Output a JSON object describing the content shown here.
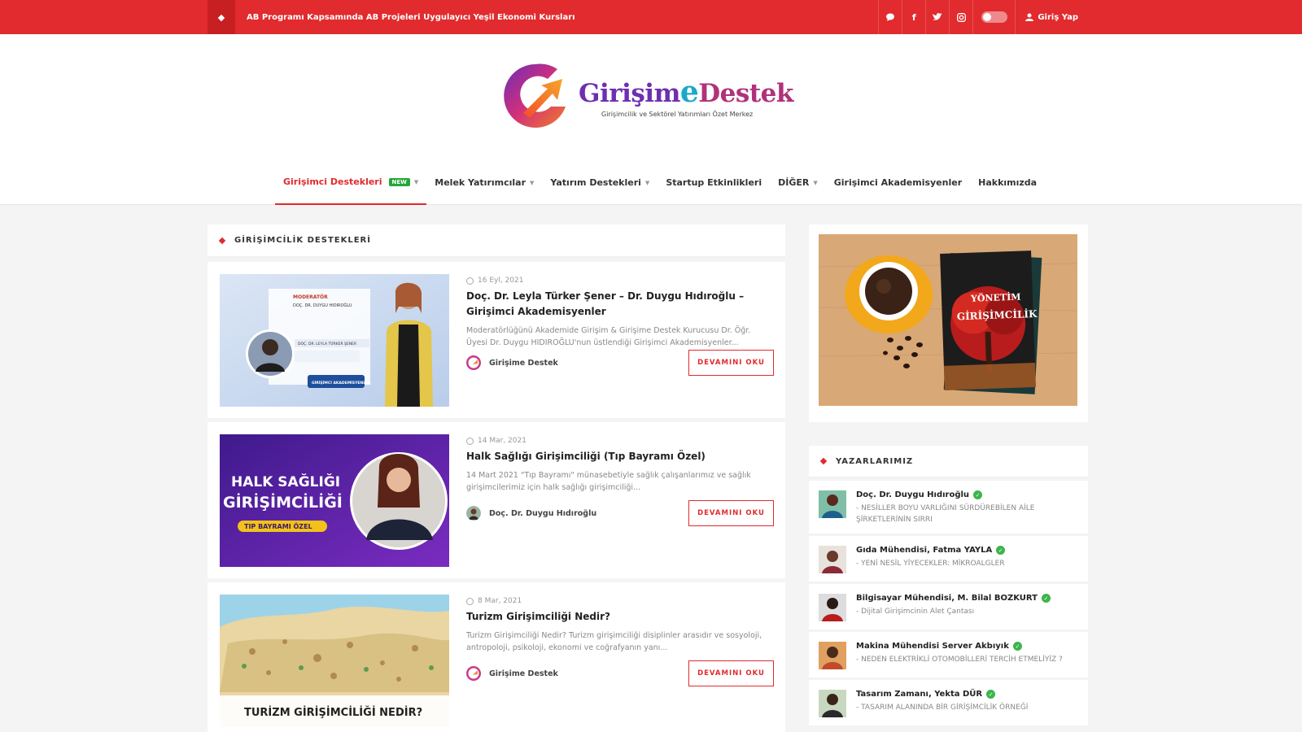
{
  "topbar": {
    "ticker": "AB Programı Kapsamında AB Projeleri Uygulayıcı Yeşil Ekonomi Kursları",
    "login_label": "Giriş Yap",
    "icons": [
      "chat-icon",
      "facebook-icon",
      "twitter-icon",
      "instagram-icon"
    ]
  },
  "header": {
    "logo_part1": "Girişim",
    "logo_e": "e",
    "logo_part2": "Destek",
    "tagline": "Girişimcilik ve Sektörel Yatırımları Özet Merkez"
  },
  "nav": {
    "items": [
      {
        "label": "Girişimci Destekleri",
        "badge": "NEW",
        "dropdown": true
      },
      {
        "label": "Melek Yatırımcılar",
        "dropdown": true
      },
      {
        "label": "Yatırım Destekleri",
        "dropdown": true
      },
      {
        "label": "Startup Etkinlikleri",
        "dropdown": false
      },
      {
        "label": "DİĞER",
        "dropdown": true
      },
      {
        "label": "Girişimci Akademisyenler",
        "dropdown": false
      },
      {
        "label": "Hakkımızda",
        "dropdown": false
      }
    ]
  },
  "main": {
    "section_title": "GİRİŞİMCİLİK DESTEKLERİ",
    "read_more": "DEVAMINI OKU",
    "posts": [
      {
        "date": "16 Eyl, 2021",
        "title": "Doç. Dr. Leyla Türker Şener – Dr. Duygu Hıdıroğlu – Girişimci Akademisyenler",
        "excerpt": "Moderatörlüğünü Akademide Girişim & Girişime Destek Kurucusu Dr. Öğr. Üyesi Dr. Duygu HIDIROĞLU'nun üstlendiği Girişimci Akademisyenler...",
        "author": "Girişime Destek"
      },
      {
        "date": "14 Mar, 2021",
        "title": "Halk Sağlığı Girişimciliği (Tıp Bayramı Özel)",
        "excerpt": "14 Mart 2021 \"Tıp Bayramı\" münasebetiyle sağlık çalışanlarımız ve sağlık girişimcilerimiz için halk sağlığı girişimciliği...",
        "author": "Doç. Dr. Duygu Hıdıroğlu"
      },
      {
        "date": "8 Mar, 2021",
        "title": "Turizm Girişimciliği Nedir?",
        "excerpt": "Turizm Girişimciliği Nedir? Turizm girişimciliği disiplinler arasıdır ve sosyoloji, antropoloji, psikoloji, ekonomi ve coğrafyanın yanı...",
        "author": "Girişime Destek"
      }
    ],
    "thumb1": {
      "tag": "MODERATÖR",
      "name": "DOÇ. DR. DUYGU HIDIROĞLU",
      "speaker": "DOÇ. DR. LEYLA TÜRKER ŞENER",
      "ribbon": "GİRİŞİMCİ AKADEMİSYENLER"
    },
    "thumb2": {
      "line1": "HALK SAĞLIĞI",
      "line2": "GİRİŞİMCİLİĞİ",
      "pill": "TIP BAYRAMI ÖZEL"
    },
    "thumb3": {
      "caption": "TURİZM GİRİŞİMCİLİĞİ NEDİR?"
    }
  },
  "sidebar": {
    "book_line1": "YÖNETİM",
    "book_line2": "GİRİŞİMCİLİK",
    "writers_title": "YAZARLARIMIZ",
    "writers": [
      {
        "name": "Doç. Dr. Duygu Hıdıroğlu",
        "post": "- NESİLLER BOYU VARLIĞINI SÜRDÜREBİLEN AİLE ŞİRKETLERİNİN SIRRI"
      },
      {
        "name": "Gıda Mühendisi, Fatma YAYLA",
        "post": "- YENİ NESİL YİYECEKLER: MİKROALGLER"
      },
      {
        "name": "Bilgisayar Mühendisi, M. Bilal BOZKURT",
        "post": "- Dijital Girişimcinin Alet Çantası"
      },
      {
        "name": "Makina Mühendisi Server Akbıyık",
        "post": "- NEDEN ELEKTRİKLİ OTOMOBİLLERİ TERCİH ETMELİYİZ ?"
      },
      {
        "name": "Tasarım Zamanı, Yekta DÜR",
        "post": "- TASARIM ALANINDA BİR GİRİŞİMCİLİK ÖRNEĞİ"
      }
    ]
  },
  "colors": {
    "brand_red": "#e12b2e",
    "accent_green": "#3cb54a"
  }
}
